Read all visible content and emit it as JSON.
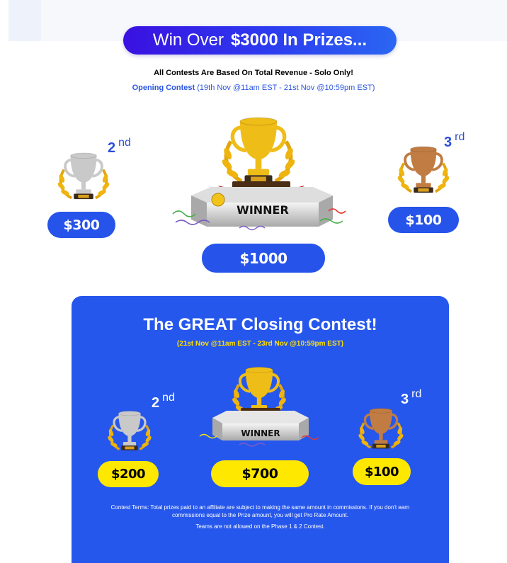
{
  "banner": {
    "prefix": "Win Over",
    "amount": "$3000 In Prizes..."
  },
  "subtitle": "All Contests Are Based On Total Revenue - Solo Only!",
  "opening": {
    "label": "Opening Contest",
    "dates": "(19th Nov @11am EST - 21st Nov @10:59pm EST)"
  },
  "opening_prizes": {
    "second": {
      "rank": "2",
      "suffix": "nd",
      "amount": "$300"
    },
    "first": {
      "badge": "WINNER",
      "amount": "$1000"
    },
    "third": {
      "rank": "3",
      "suffix": "rd",
      "amount": "$100"
    }
  },
  "closing": {
    "title": "The GREAT Closing Contest!",
    "dates": "(21st Nov @11am EST -  23rd Nov @10:59pm EST)",
    "second": {
      "rank": "2",
      "suffix": "nd",
      "amount": "$200"
    },
    "first": {
      "badge": "WINNER",
      "amount": "$700"
    },
    "third": {
      "rank": "3",
      "suffix": "rd",
      "amount": "$100"
    },
    "terms": "Contest Terms: Total prizes paid to an affiliate are subject to making the same amount in commissions. If you don't earn commissions equal to the Prize amount, you will get Pro Rate Amount.",
    "teams_note": "Teams are not allowed on the Phase 1 & 2 Contest."
  },
  "colors": {
    "blue": "#2653ea",
    "yellow": "#ffe800",
    "gold": "#f2c41a",
    "silver": "#c7c7c7",
    "bronze": "#b8743d"
  }
}
